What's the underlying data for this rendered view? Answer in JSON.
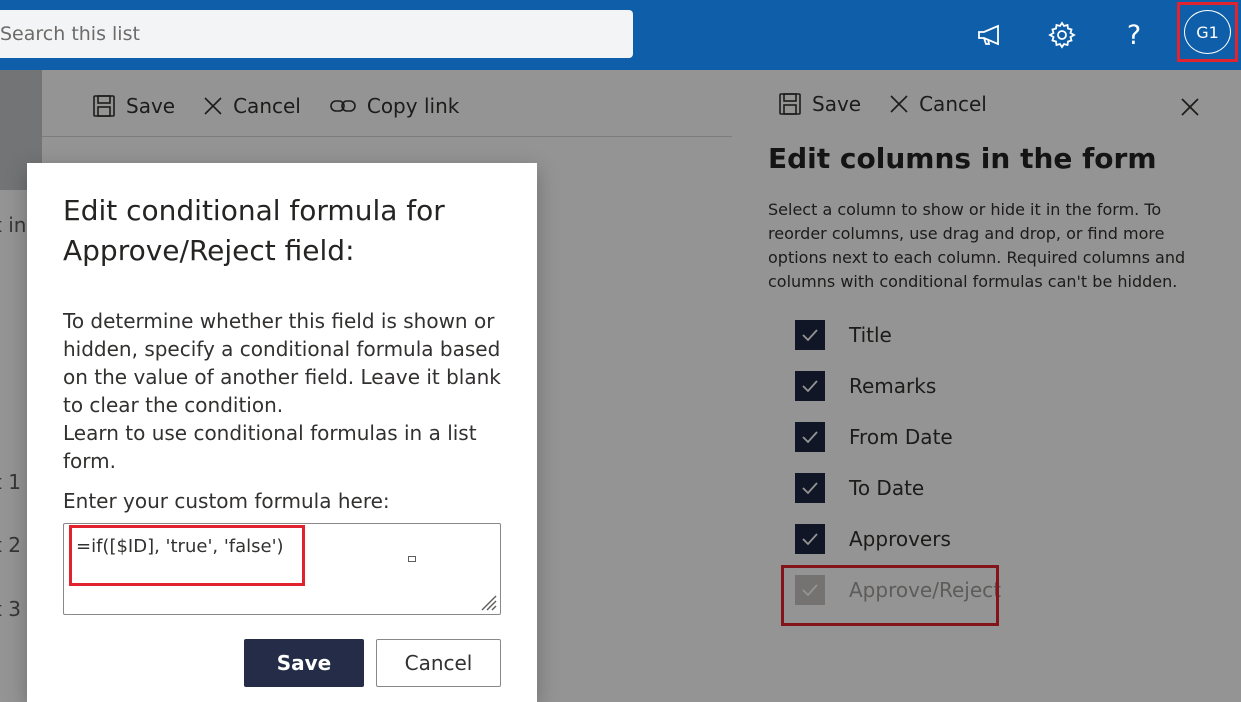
{
  "topbar": {
    "search_placeholder": "Search this list",
    "avatar_initials": "G1",
    "help_glyph": "?"
  },
  "commandbar": {
    "save": "Save",
    "cancel": "Cancel",
    "copy_link": "Copy link"
  },
  "background_peek": [
    "t in",
    "t 1",
    "t 2",
    "t 3"
  ],
  "panel": {
    "save": "Save",
    "cancel": "Cancel",
    "title": "Edit columns in the form",
    "description": "Select a column to show or hide it in the form. To reorder columns, use drag and drop, or find more options next to each column. Required columns and columns with conditional formulas can't be hidden.",
    "columns": [
      {
        "label": "Title",
        "checked": true,
        "disabled": false
      },
      {
        "label": "Remarks",
        "checked": true,
        "disabled": false
      },
      {
        "label": "From Date",
        "checked": true,
        "disabled": false
      },
      {
        "label": "To Date",
        "checked": true,
        "disabled": false
      },
      {
        "label": "Approvers",
        "checked": true,
        "disabled": false
      },
      {
        "label": "Approve/Reject",
        "checked": true,
        "disabled": true
      }
    ]
  },
  "dialog": {
    "title": "Edit conditional formula for Approve/Reject field:",
    "body_line1": "To determine whether this field is shown or hidden, specify a conditional formula based on the value of another field. Leave it blank to clear the condition.",
    "body_line2": "Learn to use conditional formulas in a list form.",
    "formula_label": "Enter your custom formula here:",
    "formula_value": "=if([$ID], 'true', 'false')",
    "save_label": "Save",
    "cancel_label": "Cancel"
  },
  "colors": {
    "suite_bar": "#0f5ea9",
    "highlight": "#e0232e",
    "primary_button": "#242c48",
    "checkbox": "#1e2742"
  }
}
